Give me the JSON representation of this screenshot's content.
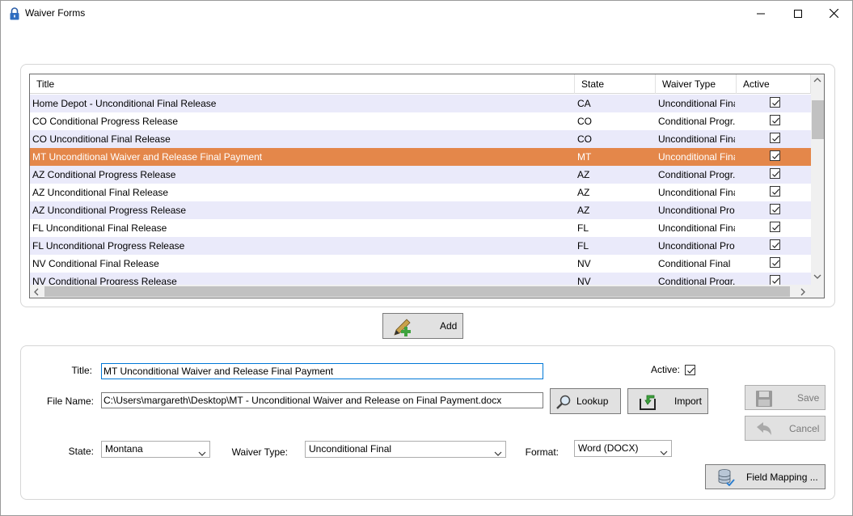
{
  "window": {
    "title": "Waiver Forms",
    "minimize_icon": "minimize-icon",
    "maximize_icon": "maximize-icon",
    "close_icon": "close-icon"
  },
  "grid": {
    "columns": [
      "Title",
      "State",
      "Waiver Type",
      "Active"
    ],
    "rows": [
      {
        "title": "Home Depot - Unconditional Final Release",
        "state": "CA",
        "type": "Unconditional Final",
        "active": true
      },
      {
        "title": "CO Conditional Progress Release",
        "state": "CO",
        "type": "Conditional Progr...",
        "active": true
      },
      {
        "title": "CO Unconditional Final Release",
        "state": "CO",
        "type": "Unconditional Final",
        "active": true
      },
      {
        "title": "MT Unconditional Waiver and Release Final Payment",
        "state": "MT",
        "type": "Unconditional Final",
        "active": true,
        "selected": true
      },
      {
        "title": "AZ Conditional Progress Release",
        "state": "AZ",
        "type": "Conditional Progr...",
        "active": true
      },
      {
        "title": "AZ Unconditional Final Release",
        "state": "AZ",
        "type": "Unconditional Final",
        "active": true
      },
      {
        "title": "AZ Unconditional Progress Release",
        "state": "AZ",
        "type": "Unconditional Pro...",
        "active": true
      },
      {
        "title": "FL Unconditional Final Release",
        "state": "FL",
        "type": "Unconditional Final",
        "active": true
      },
      {
        "title": "FL Unconditional Progress Release",
        "state": "FL",
        "type": "Unconditional Pro...",
        "active": true
      },
      {
        "title": "NV Conditional Final Release",
        "state": "NV",
        "type": "Conditional Final",
        "active": true
      },
      {
        "title": "NV Conditional Progress Release",
        "state": "NV",
        "type": "Conditional Progr...",
        "active": true
      }
    ]
  },
  "add_button": {
    "label": "Add",
    "icon": "add-pen-icon"
  },
  "form": {
    "title_label": "Title:",
    "title_value": "MT Unconditional Waiver and Release Final Payment",
    "active_label": "Active:",
    "active_checked": true,
    "file_label": "File Name:",
    "file_value": "C:\\Users\\margareth\\Desktop\\MT - Unconditional Waiver and Release on Final Payment.docx",
    "lookup_label": "Lookup",
    "import_label": "Import",
    "save_label": "Save",
    "cancel_label": "Cancel",
    "state_label": "State:",
    "state_value": "Montana",
    "waiver_type_label": "Waiver Type:",
    "waiver_type_value": "Unconditional Final",
    "format_label": "Format:",
    "format_value": "Word (DOCX)",
    "field_mapping_label": "Field Mapping ..."
  },
  "colors": {
    "selected_row": "#e4874a",
    "alt_row": "#eaeafa",
    "focus_border": "#0078d7"
  }
}
